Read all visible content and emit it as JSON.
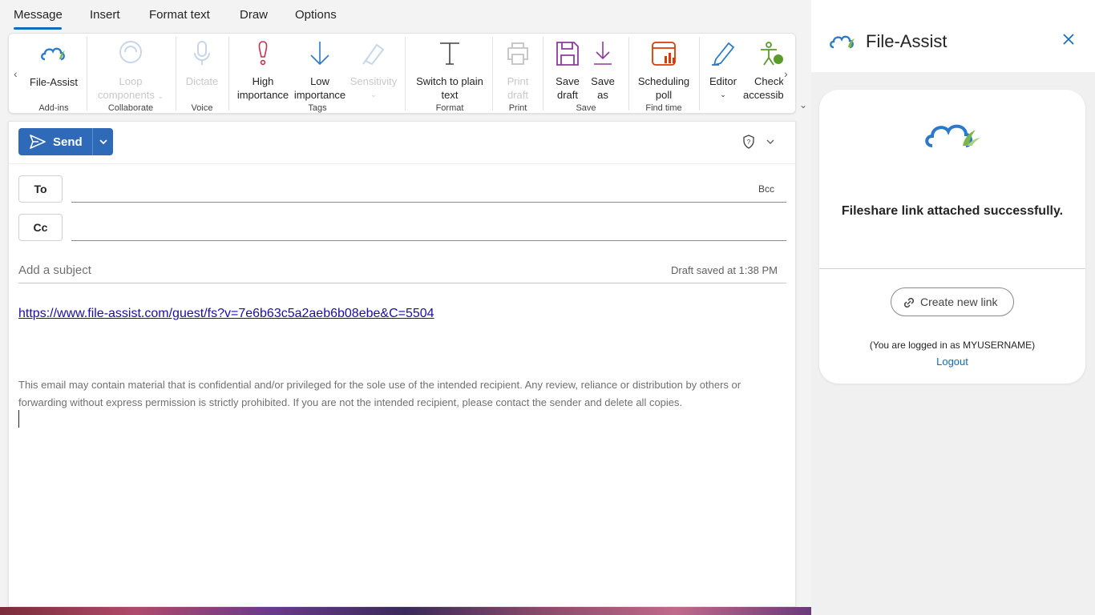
{
  "tabs": [
    {
      "label": "Message",
      "active": true
    },
    {
      "label": "Insert"
    },
    {
      "label": "Format text"
    },
    {
      "label": "Draw"
    },
    {
      "label": "Options"
    }
  ],
  "ribbon": {
    "file_assist": "File-Assist",
    "loop_1": "Loop",
    "loop_2": "components",
    "dictate": "Dictate",
    "high_1": "High",
    "high_2": "importance",
    "low_1": "Low",
    "low_2": "importance",
    "sensitivity": "Sensitivity",
    "plain_1": "Switch to plain",
    "plain_2": "text",
    "print_1": "Print",
    "print_2": "draft",
    "save_draft_1": "Save",
    "save_draft_2": "draft",
    "save_as_1": "Save",
    "save_as_2": "as",
    "poll_1": "Scheduling",
    "poll_2": "poll",
    "editor": "Editor",
    "check_1": "Check",
    "check_2": "accessibility",
    "groups": {
      "addins": "Add-ins",
      "collaborate": "Collaborate",
      "voice": "Voice",
      "tags": "Tags",
      "format": "Format",
      "print": "Print",
      "save": "Save",
      "findtime": "Find time"
    }
  },
  "compose": {
    "send_label": "Send",
    "to_label": "To",
    "cc_label": "Cc",
    "bcc_label": "Bcc",
    "subject_placeholder": "Add a subject",
    "draft_saved": "Draft saved at 1:38 PM",
    "link": "https://www.file-assist.com/guest/fs?v=7e6b63c5a2aeb6b08ebe&C=5504",
    "disclaimer": "This email may contain material that is confidential and/or privileged for the sole use of the intended recipient. Any review, reliance or distribution by others or forwarding without express permission is strictly prohibited. If you are not the intended recipient, please contact the sender and delete all copies."
  },
  "panel": {
    "title": "File-Assist",
    "success": "Fileshare link attached successfully.",
    "create_link": "Create new link",
    "logged_in": "(You are logged in as MYUSERNAME)",
    "logout": "Logout"
  },
  "colors": {
    "accent": "#0f6cbd",
    "send": "#2f6ab8",
    "link": "#1a0dab"
  }
}
